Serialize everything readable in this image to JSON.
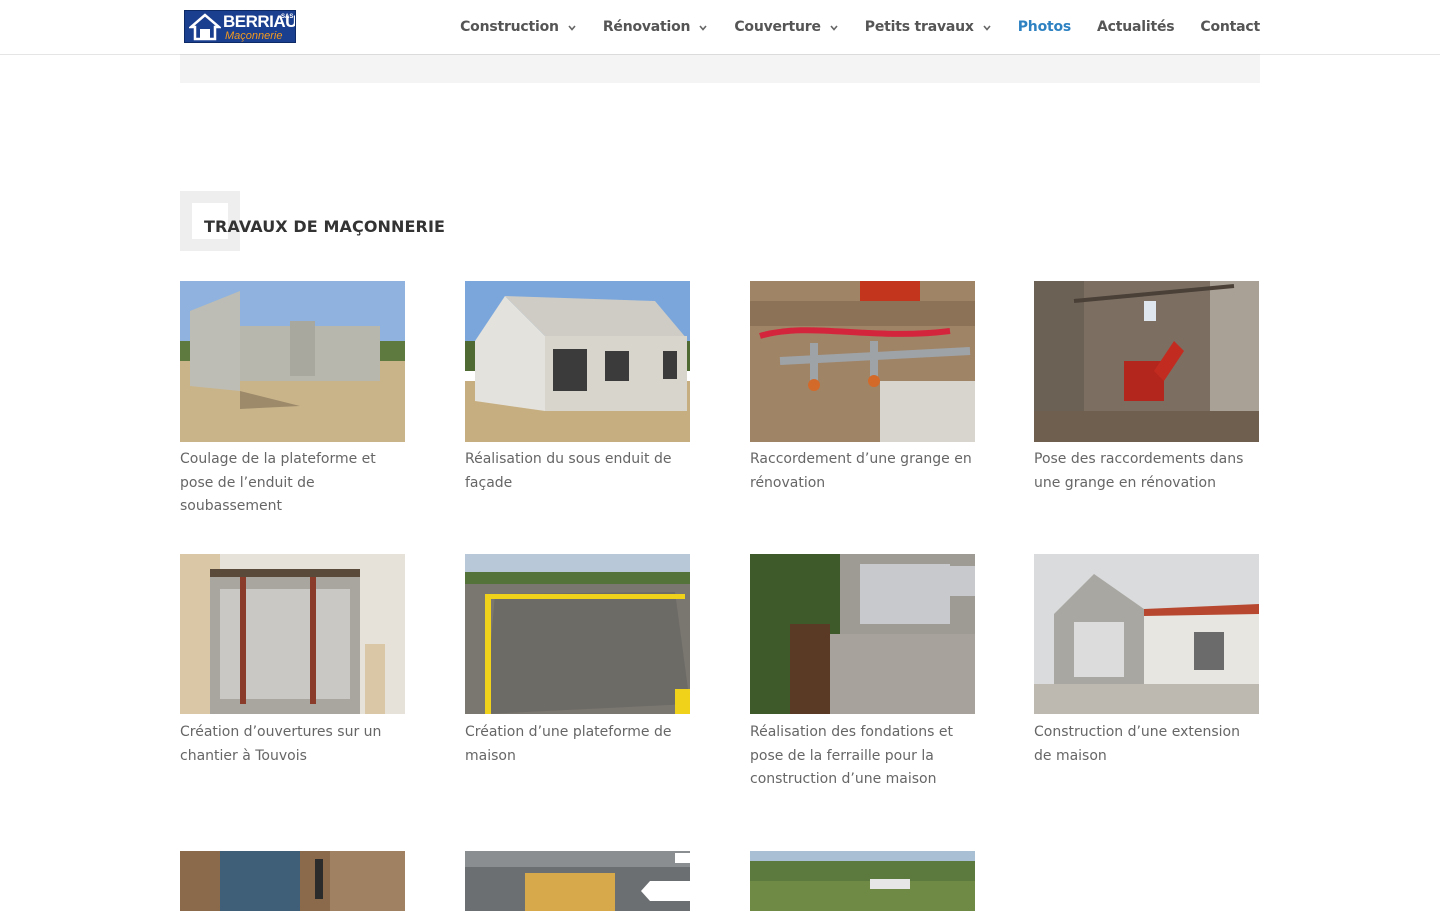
{
  "header": {
    "logo": {
      "name": "BERRIAU",
      "sas": "SAS",
      "subtitle": "Maçonnerie"
    },
    "nav": [
      {
        "label": "Construction",
        "dropdown": true,
        "active": false
      },
      {
        "label": "Rénovation",
        "dropdown": true,
        "active": false
      },
      {
        "label": "Couverture",
        "dropdown": true,
        "active": false
      },
      {
        "label": "Petits travaux",
        "dropdown": true,
        "active": false
      },
      {
        "label": "Photos",
        "dropdown": false,
        "active": true
      },
      {
        "label": "Actualités",
        "dropdown": false,
        "active": false
      },
      {
        "label": "Contact",
        "dropdown": false,
        "active": false
      }
    ]
  },
  "section": {
    "title": "TRAVAUX DE MAÇONNERIE"
  },
  "gallery": [
    {
      "caption": "Coulage de la plateforme et pose de l’enduit de soubassement"
    },
    {
      "caption": "Réalisation du sous enduit de façade"
    },
    {
      "caption": "Raccordement d’une grange en rénovation"
    },
    {
      "caption": "Pose des raccordements dans une grange en rénovation"
    },
    {
      "caption": "Création d’ouvertures sur un chantier à Touvois"
    },
    {
      "caption": "Création d’une plateforme de maison"
    },
    {
      "caption": "Réalisation des fondations et pose de la ferraille pour la construction d’une maison"
    },
    {
      "caption": "Construction d’une extension de maison"
    },
    {
      "caption": ""
    },
    {
      "caption": ""
    },
    {
      "caption": ""
    }
  ],
  "colors": {
    "accent": "#2e82c2",
    "text": "#666666",
    "heading": "#333333"
  }
}
